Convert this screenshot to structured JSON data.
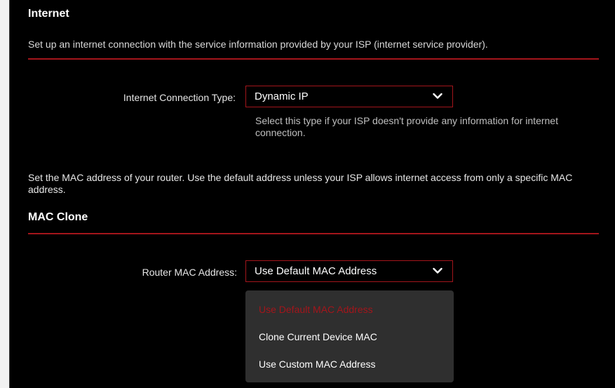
{
  "internet": {
    "title": "Internet",
    "description": "Set up an internet connection with the service information provided by your ISP (internet service provider).",
    "connection_type_label": "Internet Connection Type:",
    "connection_type_value": "Dynamic IP",
    "connection_type_hint": "Select this type if your ISP doesn't provide any information for internet connection."
  },
  "mac_clone": {
    "intro": "Set the MAC address of your router. Use the default address unless your ISP allows internet access from only a specific MAC address.",
    "title": "MAC Clone",
    "router_mac_label": "Router MAC Address:",
    "router_mac_value": "Use Default MAC Address",
    "options": [
      "Use Default MAC Address",
      "Clone Current Device MAC",
      "Use Custom MAC Address"
    ],
    "selected_option": "Use Default MAC Address"
  },
  "colors": {
    "accent": "#a3151b",
    "background": "#000000",
    "menu_background": "#2f2f2f",
    "text": "#ffffff"
  },
  "icons": {
    "dropdown": "chevron-down-icon"
  }
}
